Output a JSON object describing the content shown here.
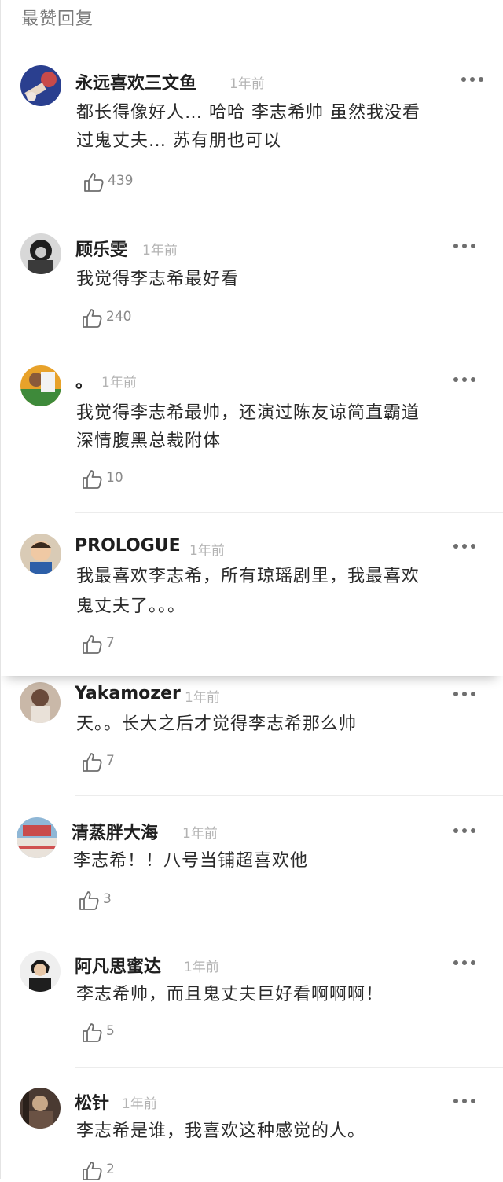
{
  "header": {
    "title": "最赞回复"
  },
  "comments": [
    {
      "username": "永远喜欢三文鱼",
      "time": "1年前",
      "lines": [
        "都长得像好人… 哈哈 李志希帅 虽然我没看",
        "过鬼丈夫… 苏有朋也可以"
      ],
      "likes": "439"
    },
    {
      "username": "顾乐雯",
      "time": "1年前",
      "lines": [
        "我觉得李志希最好看"
      ],
      "likes": "240"
    },
    {
      "username": "。",
      "time": "1年前",
      "lines": [
        "我觉得李志希最帅，还演过陈友谅简直霸道",
        "深情腹黑总裁附体"
      ],
      "likes": "10"
    },
    {
      "username": "PROLOGUE",
      "time": "1年前",
      "lines": [
        "我最喜欢李志希，所有琼瑶剧里，我最喜欢",
        "鬼丈夫了。。。"
      ],
      "likes": "7"
    },
    {
      "username": "Yakamozer",
      "time": "1年前",
      "lines": [
        "天。。长大之后才觉得李志希那么帅"
      ],
      "likes": "7"
    },
    {
      "username": "清蒸胖大海",
      "time": "1年前",
      "lines": [
        "李志希！！八号当铺超喜欢他"
      ],
      "likes": "3"
    },
    {
      "username": "阿凡思蜜达",
      "time": "1年前",
      "lines": [
        "李志希帅，而且鬼丈夫巨好看啊啊啊！"
      ],
      "likes": "5"
    },
    {
      "username": "松针",
      "time": "1年前",
      "lines": [
        "李志希是谁，我喜欢这种感觉的人。"
      ],
      "likes": "2"
    }
  ],
  "icons": {
    "like": "thumbs-up-icon",
    "more": "more-dots-icon"
  }
}
